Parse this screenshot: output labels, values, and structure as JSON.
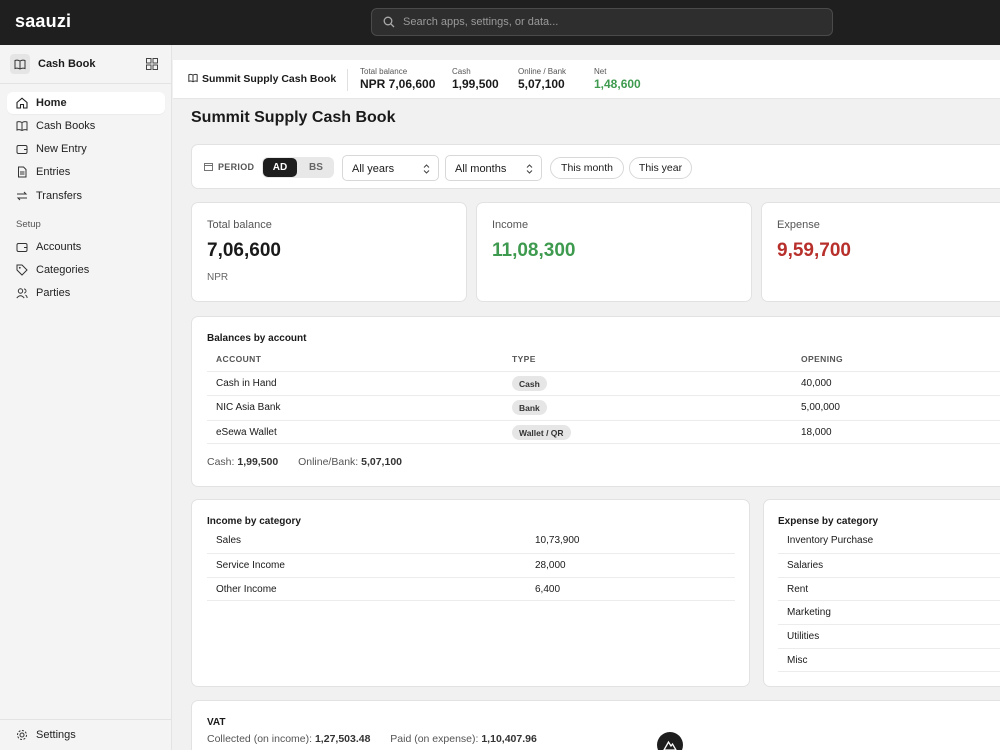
{
  "app": {
    "logo": "saauzi"
  },
  "search": {
    "placeholder": "Search apps, settings, or data..."
  },
  "sidebar": {
    "title": "Cash Book",
    "nav": [
      {
        "label": "Home",
        "icon": "home-icon"
      },
      {
        "label": "Cash Books",
        "icon": "book-icon"
      },
      {
        "label": "New Entry",
        "icon": "wallet-icon"
      },
      {
        "label": "Entries",
        "icon": "document-icon"
      },
      {
        "label": "Transfers",
        "icon": "transfer-icon"
      }
    ],
    "setup_label": "Setup",
    "setup": [
      {
        "label": "Accounts",
        "icon": "wallet-icon"
      },
      {
        "label": "Categories",
        "icon": "tag-icon"
      },
      {
        "label": "Parties",
        "icon": "users-icon"
      }
    ],
    "settings_label": "Settings"
  },
  "summary": {
    "book_name": "Summit Supply Cash Book",
    "total_balance_label": "Total balance",
    "total_balance": "NPR 7,06,600",
    "cash_label": "Cash",
    "cash": "1,99,500",
    "online_label": "Online / Bank",
    "online": "5,07,100",
    "net_label": "Net",
    "net": "1,48,600"
  },
  "page": {
    "title": "Summit Supply Cash Book"
  },
  "filters": {
    "period_label": "PERIOD",
    "calendar_ad": "AD",
    "calendar_bs": "BS",
    "year_select": "All years",
    "month_select": "All months",
    "this_month": "This month",
    "this_year": "This year"
  },
  "stats": {
    "total_balance": {
      "label": "Total balance",
      "value": "7,06,600",
      "currency": "NPR"
    },
    "income": {
      "label": "Income",
      "value": "11,08,300"
    },
    "expense": {
      "label": "Expense",
      "value": "9,59,700"
    }
  },
  "balances": {
    "title": "Balances by account",
    "headers": {
      "account": "ACCOUNT",
      "type": "TYPE",
      "opening": "OPENING"
    },
    "rows": [
      {
        "account": "Cash in Hand",
        "type": "Cash",
        "opening": "40,000"
      },
      {
        "account": "NIC Asia Bank",
        "type": "Bank",
        "opening": "5,00,000"
      },
      {
        "account": "eSewa Wallet",
        "type": "Wallet / QR",
        "opening": "18,000"
      }
    ],
    "footer_cash_label": "Cash:",
    "footer_cash": "1,99,500",
    "footer_online_label": "Online/Bank:",
    "footer_online": "5,07,100"
  },
  "income_by_category": {
    "title": "Income by category",
    "rows": [
      {
        "name": "Sales",
        "amount": "10,73,900"
      },
      {
        "name": "Service Income",
        "amount": "28,000"
      },
      {
        "name": "Other Income",
        "amount": "6,400"
      }
    ]
  },
  "expense_by_category": {
    "title": "Expense by category",
    "rows": [
      {
        "name": "Inventory Purchase"
      },
      {
        "name": "Salaries"
      },
      {
        "name": "Rent"
      },
      {
        "name": "Marketing"
      },
      {
        "name": "Utilities"
      },
      {
        "name": "Misc"
      }
    ]
  },
  "vat": {
    "title": "VAT",
    "collected_label": "Collected (on income):",
    "collected": "1,27,503.48",
    "paid_label": "Paid (on expense):",
    "paid": "1,10,407.96"
  },
  "colors": {
    "positive": "#3e9a4e",
    "negative": "#b8302c",
    "topbar": "#1f1f1f"
  }
}
